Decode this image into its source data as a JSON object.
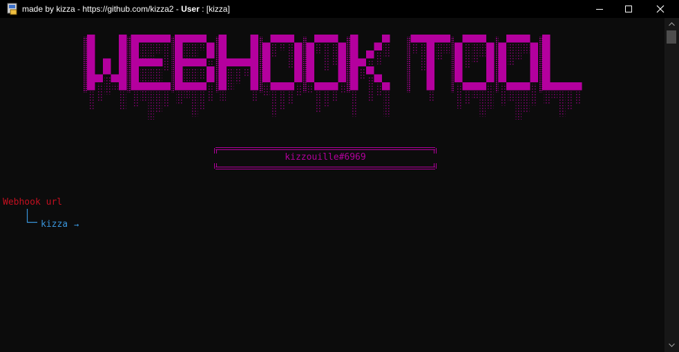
{
  "window": {
    "title_prefix": "made by kizza - https://github.com/kizza2 - ",
    "title_user_label": "User",
    "title_suffix": " : [kizza]"
  },
  "console": {
    "banner_text": "WEBHOOK TOOL",
    "badge_text": "kizzouille#6969",
    "prompt_label": "Webhook url",
    "prompt_user": "kizza",
    "prompt_arrow": "→"
  },
  "colors": {
    "background": "#0c0c0c",
    "banner": "#b4009e",
    "prompt_label": "#c50f1f",
    "prompt_user": "#3a96dd",
    "tree": "#3a96dd"
  },
  "icons": [
    "app-icon",
    "minimize-icon",
    "maximize-icon",
    "close-icon",
    "scroll-up-icon",
    "scroll-down-icon"
  ]
}
